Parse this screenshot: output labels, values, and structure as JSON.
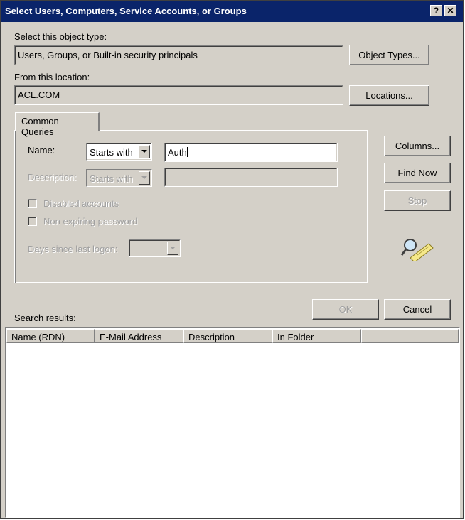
{
  "window": {
    "title": "Select Users, Computers, Service Accounts, or Groups",
    "help_glyph": "?",
    "close_glyph": "✕"
  },
  "object_type": {
    "label": "Select this object type:",
    "value": "Users, Groups, or Built-in security principals",
    "button": "Object Types..."
  },
  "location": {
    "label": "From this location:",
    "value": "ACL.COM",
    "button": "Locations..."
  },
  "queries": {
    "tab_label": "Common Queries",
    "name_label": "Name:",
    "name_mode": "Starts with",
    "name_value": "Auth",
    "description_label": "Description:",
    "description_mode": "Starts with",
    "description_value": "",
    "disabled_accounts": "Disabled accounts",
    "non_expiring_password": "Non expiring password",
    "days_since_logon": "Days since last logon:",
    "days_value": ""
  },
  "side_buttons": {
    "columns": "Columns...",
    "find_now": "Find Now",
    "stop": "Stop"
  },
  "dialog_buttons": {
    "ok": "OK",
    "cancel": "Cancel"
  },
  "results": {
    "label": "Search results:",
    "columns": [
      "Name (RDN)",
      "E-Mail Address",
      "Description",
      "In Folder"
    ]
  }
}
